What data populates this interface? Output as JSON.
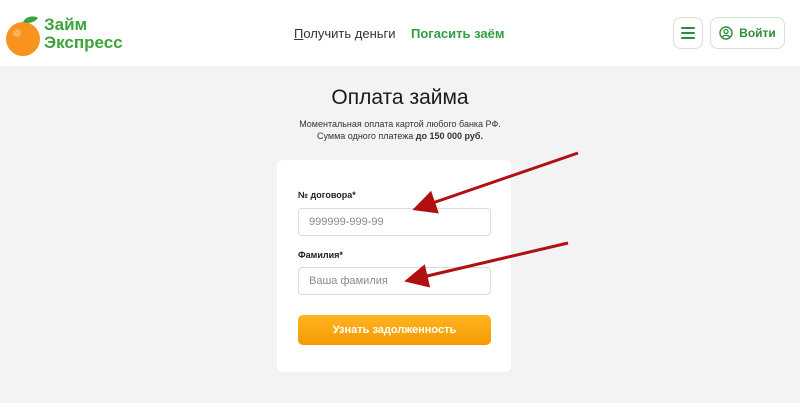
{
  "header": {
    "logo": {
      "line1": "Займ",
      "line2": "Экспресс"
    },
    "nav": {
      "get_money_first": "П",
      "get_money_rest": "олучить деньги",
      "repay_loan": "Погасить заём"
    },
    "menu_icon": "hamburger-icon",
    "login_label": "Войти",
    "login_icon": "user-circle-icon"
  },
  "page": {
    "title": "Оплата займа",
    "subtitle_line1": "Моментальная оплата картой любого банка РФ.",
    "subtitle_line2_prefix": "Сумма одного платежа ",
    "subtitle_line2_bold": "до 150 000 руб."
  },
  "form": {
    "contract_label": "№ договора*",
    "contract_placeholder": "999999-999-99",
    "contract_value": "",
    "surname_label": "Фамилия*",
    "surname_placeholder": "Ваша фамилия",
    "surname_value": "",
    "submit_label": "Узнать задолженность"
  },
  "colors": {
    "brand_green": "#3aa53a",
    "accent_orange": "#f59a00",
    "annotation_red": "#b01010"
  }
}
